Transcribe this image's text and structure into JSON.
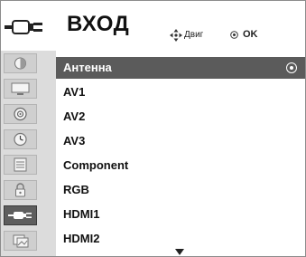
{
  "header": {
    "icon": "input-plug-icon",
    "title": "ВХОД",
    "hints": {
      "move_icon": "four-way-arrow-icon",
      "move_label": "Двиг",
      "ok_icon": "ok-circle-icon",
      "ok_label": "OK"
    }
  },
  "sidebar": {
    "items": [
      {
        "name": "picture",
        "icon": "picture-icon"
      },
      {
        "name": "screen",
        "icon": "screen-icon"
      },
      {
        "name": "sound",
        "icon": "sound-icon"
      },
      {
        "name": "time",
        "icon": "clock-icon"
      },
      {
        "name": "option",
        "icon": "option-icon"
      },
      {
        "name": "lock",
        "icon": "lock-icon"
      },
      {
        "name": "input",
        "icon": "input-plug-icon",
        "active": true
      },
      {
        "name": "usb",
        "icon": "usb-photo-icon"
      }
    ]
  },
  "menu": {
    "items": [
      {
        "label": "Антенна",
        "selected": true
      },
      {
        "label": "AV1"
      },
      {
        "label": "AV2"
      },
      {
        "label": "AV3"
      },
      {
        "label": "Component"
      },
      {
        "label": "RGB"
      },
      {
        "label": "HDMI1"
      },
      {
        "label": "HDMI2"
      }
    ],
    "scroll_icon": "scroll-down-arrow-icon"
  },
  "colors": {
    "selected_bg": "#5b5b5b",
    "sidebar_bg": "#dcdcdc",
    "text": "#111111"
  }
}
